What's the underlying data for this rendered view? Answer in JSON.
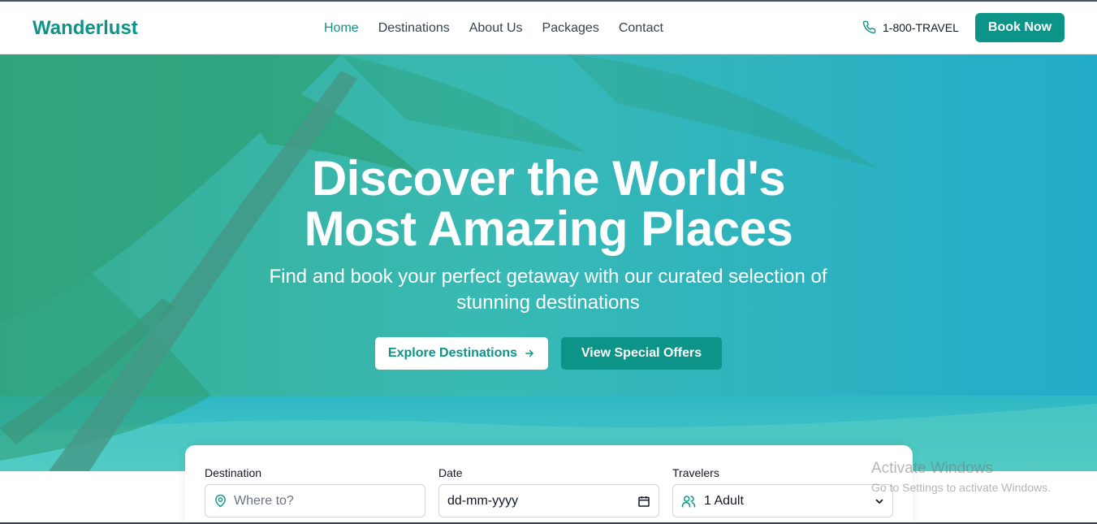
{
  "brand": "Wanderlust",
  "nav": {
    "items": [
      "Home",
      "Destinations",
      "About Us",
      "Packages",
      "Contact"
    ],
    "active": "Home"
  },
  "contact": {
    "phone": "1-800-TRAVEL",
    "icon": "phone-icon"
  },
  "header": {
    "book_label": "Book Now"
  },
  "hero": {
    "title_line1": "Discover the World's",
    "title_line2": "Most Amazing Places",
    "subtitle": "Find and book your perfect getaway with our curated selection of stunning destinations",
    "explore_label": "Explore Destinations",
    "offers_label": "View Special Offers"
  },
  "search": {
    "destination_label": "Destination",
    "destination_placeholder": "Where to?",
    "date_label": "Date",
    "date_placeholder": "dd-mm-yyyy",
    "travelers_label": "Travelers",
    "travelers_value": "1 Adult"
  },
  "watermark": {
    "line1": "Activate Windows",
    "line2": "Go to Settings to activate Windows."
  },
  "colors": {
    "accent": "#0d9488",
    "hero_overlay": "#2ec4b6"
  }
}
